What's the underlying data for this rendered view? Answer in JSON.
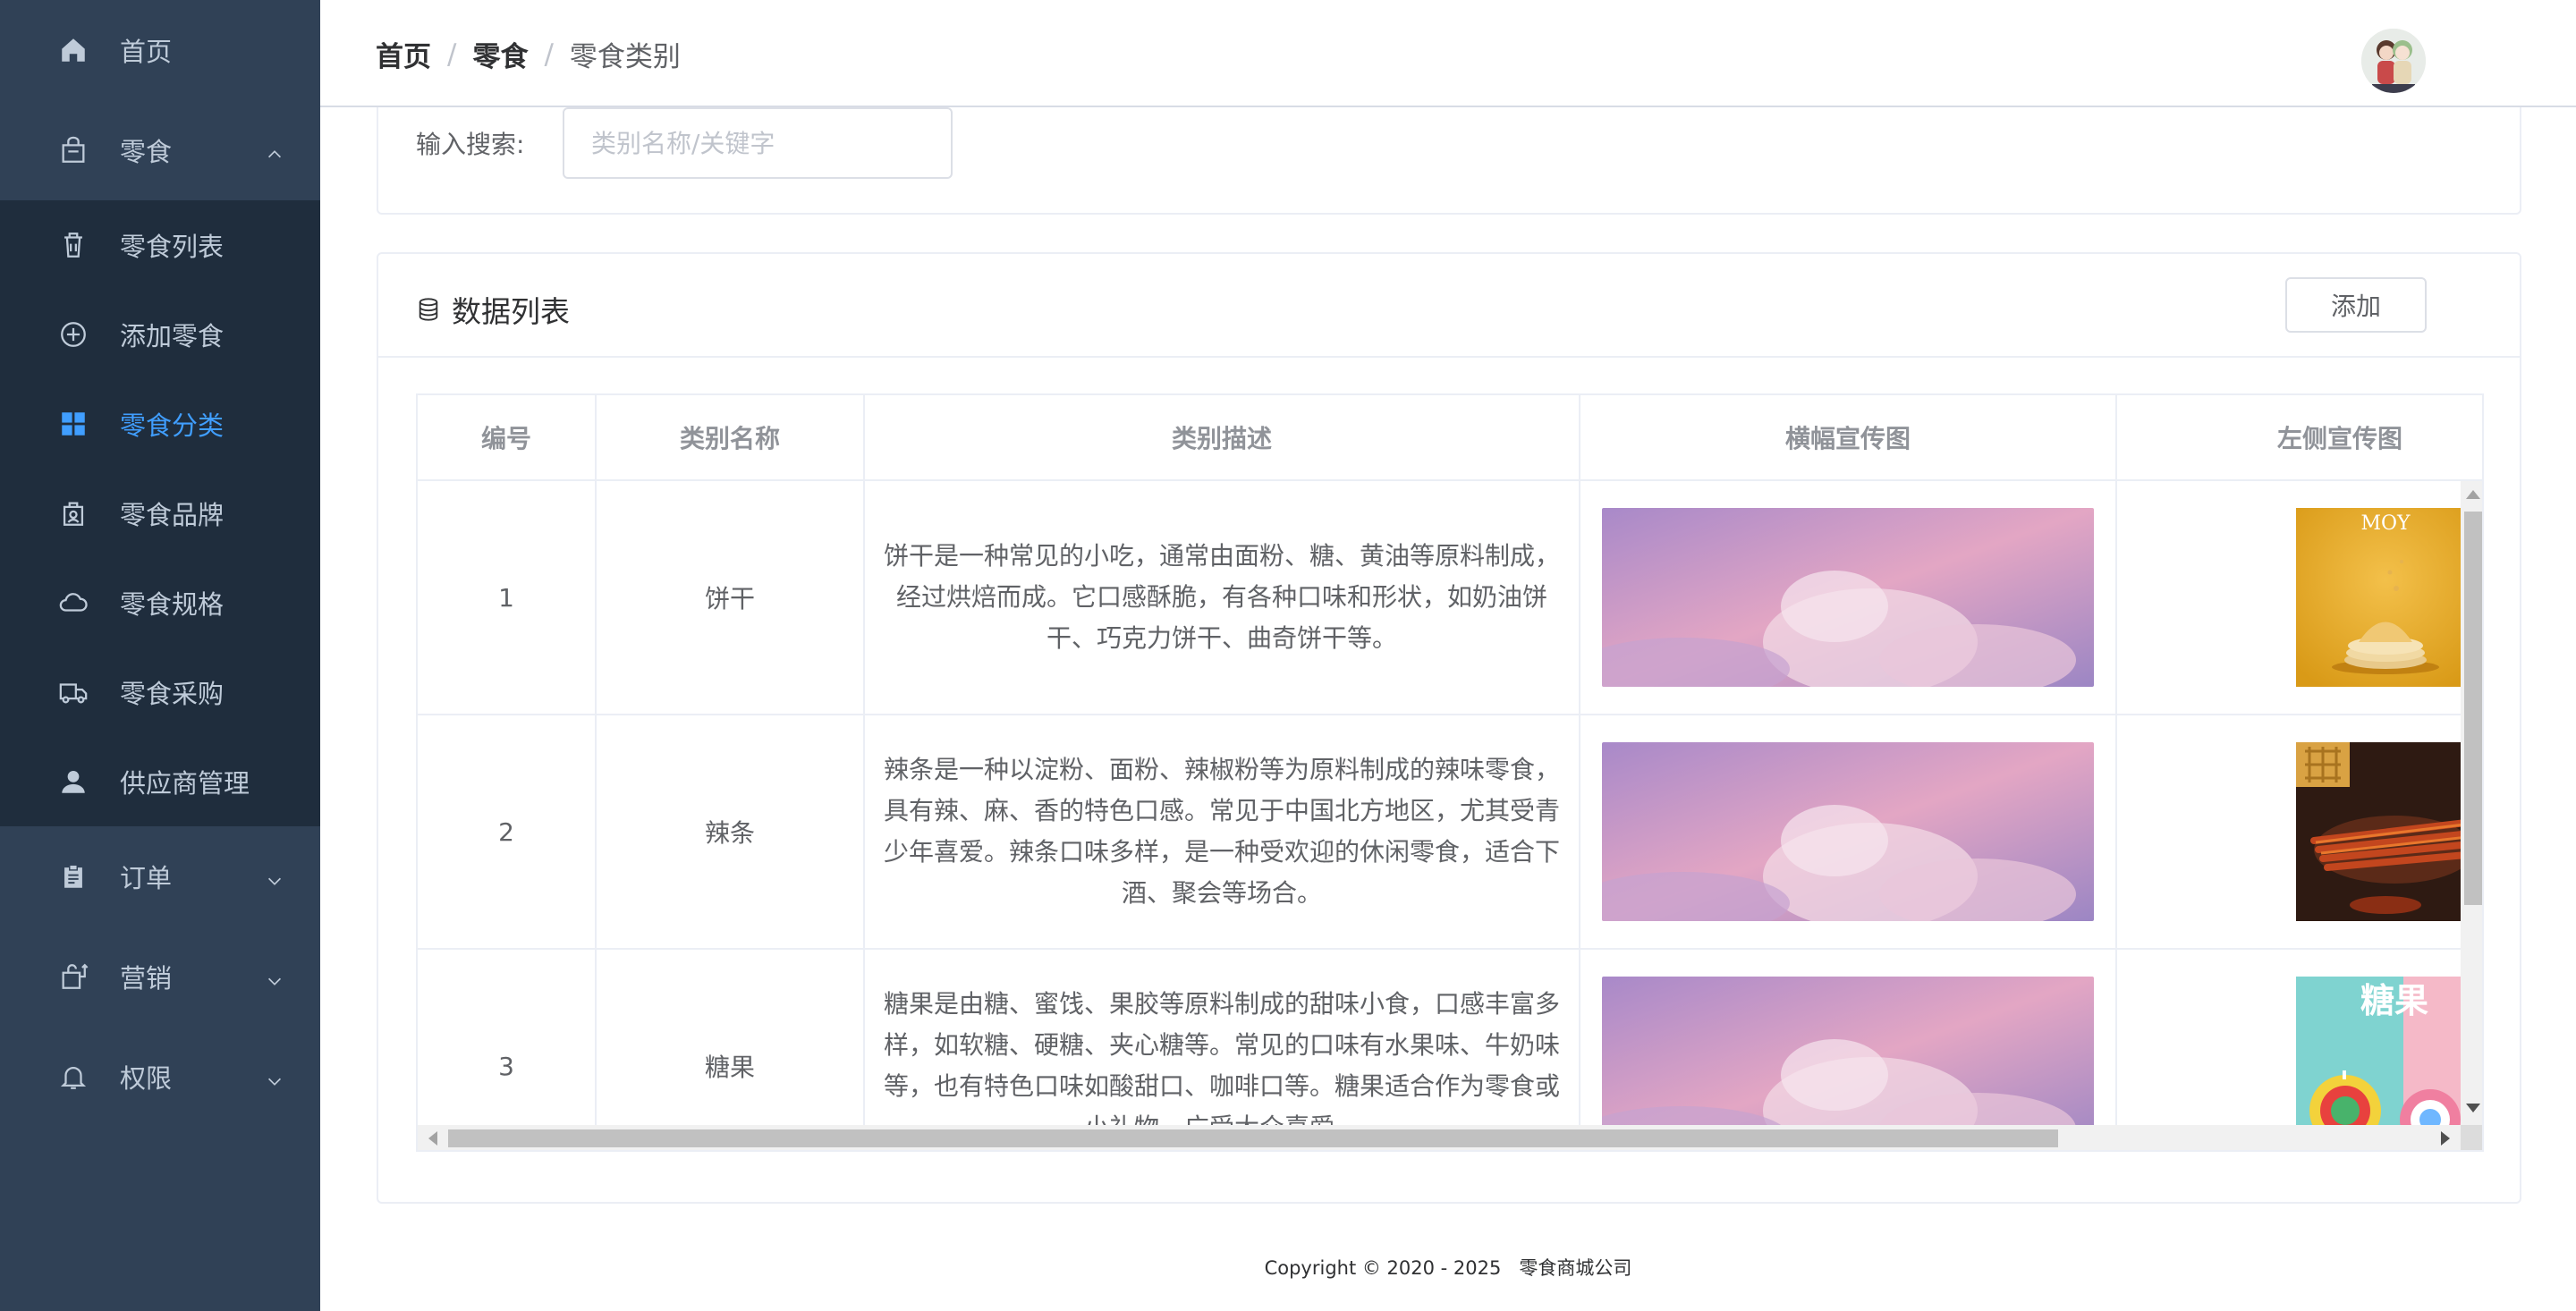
{
  "sidebar": {
    "home": {
      "label": "首页",
      "icon": "home-icon"
    },
    "snack": {
      "label": "零食",
      "icon": "bag-icon",
      "expanded": true
    },
    "snack_sub": [
      {
        "label": "零食列表",
        "icon": "trash-bin-icon"
      },
      {
        "label": "添加零食",
        "icon": "plus-circle-icon"
      },
      {
        "label": "零食分类",
        "icon": "grid-icon",
        "active": true
      },
      {
        "label": "零食品牌",
        "icon": "badge-icon"
      },
      {
        "label": "零食规格",
        "icon": "cloud-icon"
      },
      {
        "label": "零食采购",
        "icon": "truck-icon"
      },
      {
        "label": "供应商管理",
        "icon": "user-icon"
      }
    ],
    "order": {
      "label": "订单",
      "icon": "clipboard-icon"
    },
    "marketing": {
      "label": "营销",
      "icon": "shopping-bag-icon"
    },
    "permission": {
      "label": "权限",
      "icon": "bell-icon"
    }
  },
  "header": {
    "breadcrumb": [
      "首页",
      "零食",
      "零食类别"
    ],
    "separator": "/"
  },
  "search": {
    "label": "输入搜索:",
    "placeholder": "类别名称/关键字",
    "value": ""
  },
  "list": {
    "title": "数据列表",
    "add_label": "添加",
    "columns": [
      "编号",
      "类别名称",
      "类别描述",
      "横幅宣传图",
      "左侧宣传图"
    ],
    "rows": [
      {
        "id": "1",
        "name": "饼干",
        "description": "饼干是一种常见的小吃，通常由面粉、糖、黄油等原料制成，经过烘焙而成。它口感酥脆，有各种口味和形状，如奶油饼干、巧克力饼干、曲奇饼干等。",
        "side_text": "MOY"
      },
      {
        "id": "2",
        "name": "辣条",
        "description": "辣条是一种以淀粉、面粉、辣椒粉等为原料制成的辣味零食，具有辣、麻、香的特色口感。常见于中国北方地区，尤其受青少年喜爱。辣条口味多样，是一种受欢迎的休闲零食，适合下酒、聚会等场合。",
        "side_text": ""
      },
      {
        "id": "3",
        "name": "糖果",
        "description": "糖果是由糖、蜜饯、果胶等原料制成的甜味小食，口感丰富多样，如软糖、硬糖、夹心糖等。常见的口味有水果味、牛奶味等，也有特色口味如酸甜口、咖啡口等。糖果适合作为零食或小礼物，广受大众喜爱。",
        "side_text": "糖果"
      }
    ]
  },
  "footer": {
    "text": "Copyright © 2020 - 2025   零食商城公司"
  },
  "colors": {
    "sidebar_bg": "#304156",
    "submenu_bg": "#1f2d3d",
    "active": "#409eff",
    "menu_text": "#bfcbd9"
  }
}
